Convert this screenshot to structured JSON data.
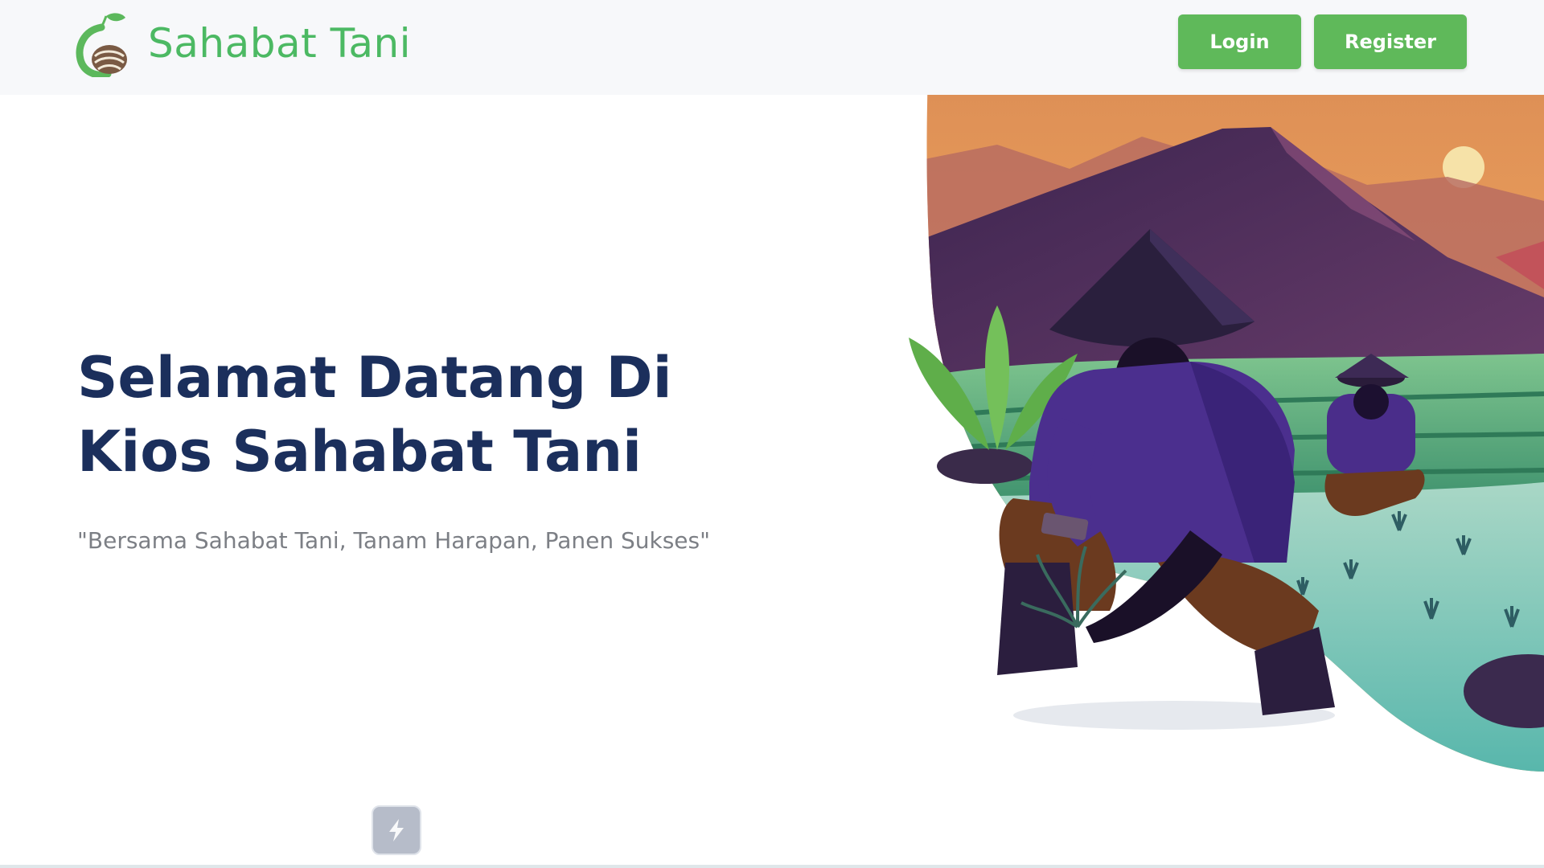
{
  "brand": {
    "name": "Sahabat Tani",
    "logo_icon": "leaf-field-logo"
  },
  "nav": {
    "login_label": "Login",
    "register_label": "Register"
  },
  "hero": {
    "title_line1": "Selamat Datang Di",
    "title_line2": "Kios Sahabat Tani",
    "tagline": "\"Bersama Sahabat Tani, Tanam Harapan, Panen Sukses\""
  },
  "widget": {
    "icon": "lightning-bolt-icon"
  },
  "colors": {
    "accent_green": "#5fb95a",
    "brand_green": "#4cb963",
    "heading_navy": "#1b2f5c",
    "tagline_gray": "#7c7f85"
  }
}
